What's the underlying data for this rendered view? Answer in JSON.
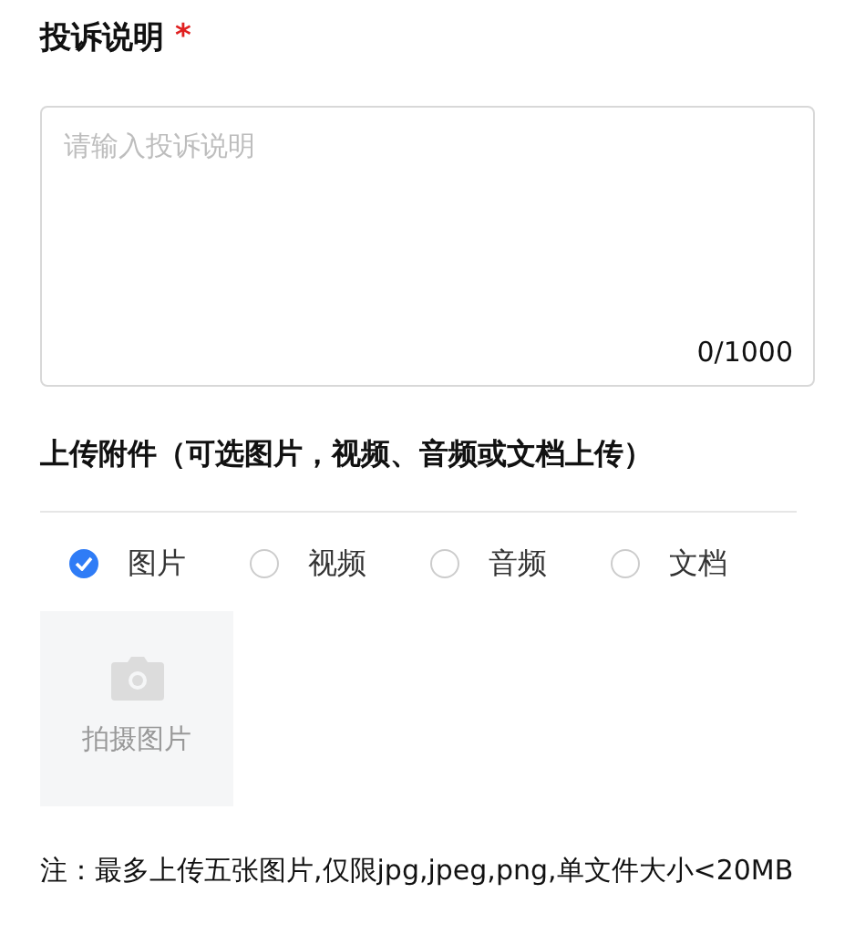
{
  "complaint": {
    "label": "投诉说明",
    "required_mark": "*",
    "placeholder": "请输入投诉说明",
    "counter": "0/1000"
  },
  "attachment": {
    "title": "上传附件（可选图片，视频、音频或文档上传）",
    "options": [
      {
        "label": "图片",
        "selected": true
      },
      {
        "label": "视频",
        "selected": false
      },
      {
        "label": "音频",
        "selected": false
      },
      {
        "label": "文档",
        "selected": false
      }
    ],
    "upload_label": "拍摄图片",
    "note": "注：最多上传五张图片,仅限jpg,jpeg,png,单文件大小<20MB"
  }
}
